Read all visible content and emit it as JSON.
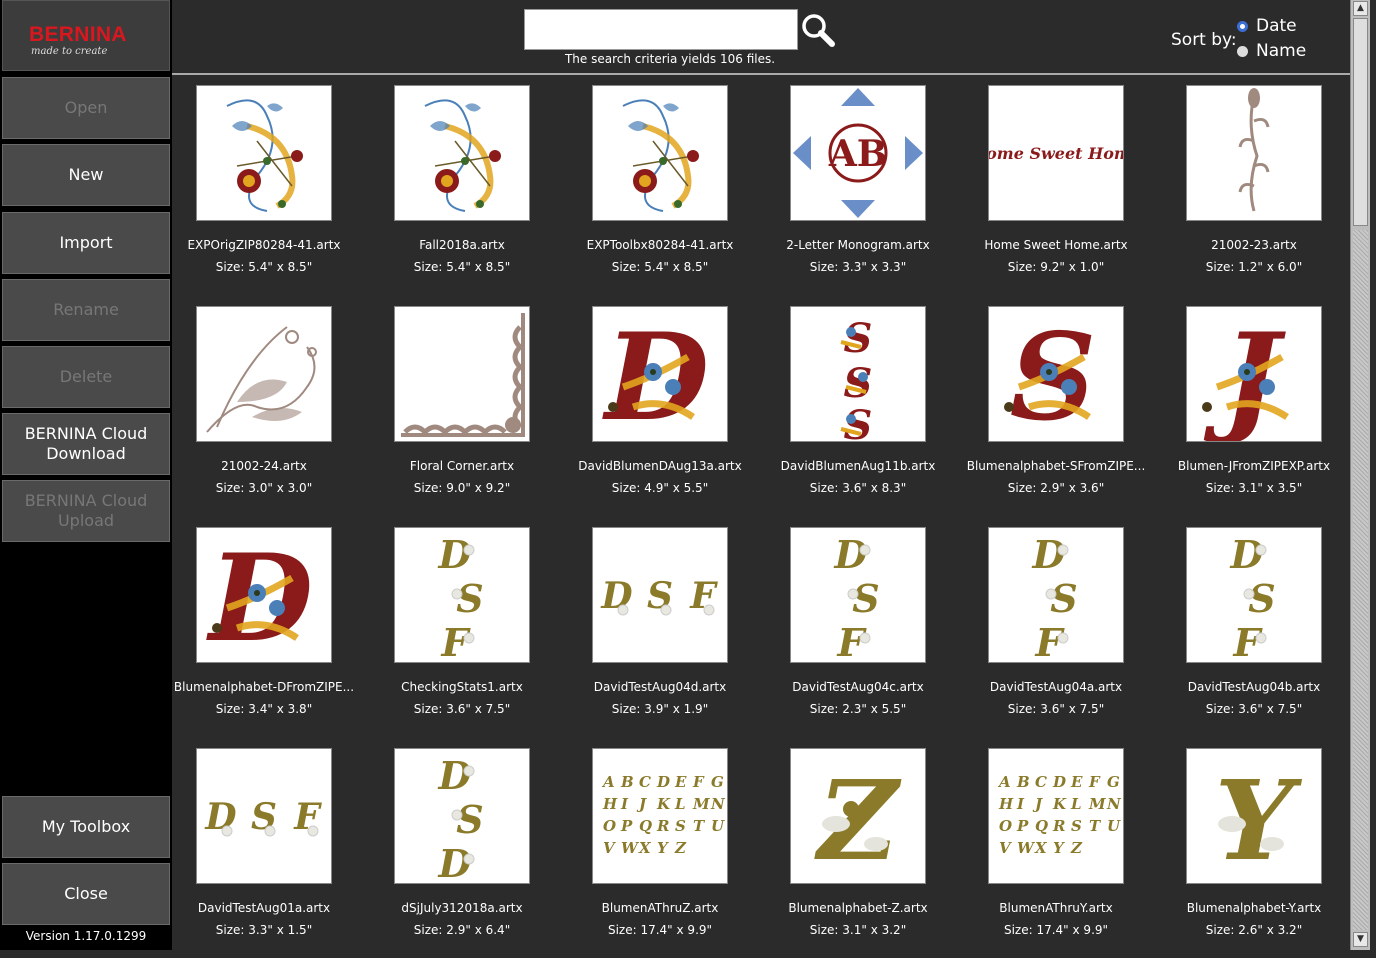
{
  "brand": {
    "name": "BERNINA",
    "tagline": "made to create"
  },
  "sidebar": {
    "buttons": [
      {
        "label": "Open",
        "enabled": false
      },
      {
        "label": "New",
        "enabled": true
      },
      {
        "label": "Import",
        "enabled": true
      },
      {
        "label": "Rename",
        "enabled": false
      },
      {
        "label": "Delete",
        "enabled": false
      },
      {
        "label": "BERNINA Cloud\nDownload",
        "enabled": true
      },
      {
        "label": "BERNINA Cloud\nUpload",
        "enabled": false
      }
    ],
    "bottom_buttons": [
      {
        "label": "My Toolbox",
        "enabled": true
      },
      {
        "label": "Close",
        "enabled": true
      }
    ],
    "version": "Version 1.17.0.1299"
  },
  "search": {
    "value": "",
    "result_text": "The search criteria yields 106 files."
  },
  "sort": {
    "label": "Sort by:",
    "options": [
      {
        "label": "Date",
        "selected": true
      },
      {
        "label": "Name",
        "selected": false
      }
    ]
  },
  "files": [
    {
      "name": "EXPOrigZIP80284-41.artx",
      "size": "Size: 5.4\" x 8.5\"",
      "art": "floral-wreath"
    },
    {
      "name": "Fall2018a.artx",
      "size": "Size: 5.4\" x 8.5\"",
      "art": "floral-wreath"
    },
    {
      "name": "EXPToolbx80284-41.artx",
      "size": "Size: 5.4\" x 8.5\"",
      "art": "floral-wreath"
    },
    {
      "name": "2-Letter Monogram.artx",
      "size": "Size: 3.3\" x 3.3\"",
      "art": "monogram",
      "art_text": "AB"
    },
    {
      "name": "Home Sweet Home.artx",
      "size": "Size: 9.2\" x 1.0\"",
      "art": "script-text",
      "art_text": "Home Sweet Home"
    },
    {
      "name": "21002-23.artx",
      "size": "Size: 1.2\" x 6.0\"",
      "art": "vine"
    },
    {
      "name": "21002-24.artx",
      "size": "Size: 3.0\" x 3.0\"",
      "art": "corner-swirl"
    },
    {
      "name": "Floral Corner.artx",
      "size": "Size: 9.0\" x 9.2\"",
      "art": "floral-corner"
    },
    {
      "name": "DavidBlumenDAug13a.artx",
      "size": "Size: 4.9\" x 5.5\"",
      "art": "letter-red",
      "art_text": "D"
    },
    {
      "name": "DavidBlumenAug11b.artx",
      "size": "Size: 3.6\" x 8.3\"",
      "art": "stack-red",
      "art_text": "S"
    },
    {
      "name": "Blumenalphabet-SFromZIPE...",
      "size": "Size: 2.9\" x 3.6\"",
      "art": "letter-red",
      "art_text": "S"
    },
    {
      "name": "Blumen-JFromZIPEXP.artx",
      "size": "Size: 3.1\" x 3.5\"",
      "art": "letter-red",
      "art_text": "J"
    },
    {
      "name": "Blumenalphabet-DFromZIPE...",
      "size": "Size: 3.4\" x 3.8\"",
      "art": "letter-red",
      "art_text": "D"
    },
    {
      "name": "CheckingStats1.artx",
      "size": "Size: 3.6\" x 7.5\"",
      "art": "stack-gold",
      "art_text": "DSF"
    },
    {
      "name": "DavidTestAug04d.artx",
      "size": "Size: 3.9\" x 1.9\"",
      "art": "row-gold",
      "art_text": "DSF"
    },
    {
      "name": "DavidTestAug04c.artx",
      "size": "Size: 2.3\" x 5.5\"",
      "art": "stack-gold",
      "art_text": "DSF"
    },
    {
      "name": "DavidTestAug04a.artx",
      "size": "Size: 3.6\" x 7.5\"",
      "art": "stack-gold",
      "art_text": "DSF"
    },
    {
      "name": "DavidTestAug04b.artx",
      "size": "Size: 3.6\" x 7.5\"",
      "art": "stack-gold",
      "art_text": "DSF"
    },
    {
      "name": "DavidTestAug01a.artx",
      "size": "Size: 3.3\" x 1.5\"",
      "art": "row-gold",
      "art_text": "DSF"
    },
    {
      "name": "dSjJuly312018a.artx",
      "size": "Size: 2.9\" x 6.4\"",
      "art": "stack-gold",
      "art_text": "DSD"
    },
    {
      "name": "BlumenAThruZ.artx",
      "size": "Size: 17.4\" x 9.9\"",
      "art": "alphabet-grid"
    },
    {
      "name": "Blumenalphabet-Z.artx",
      "size": "Size: 3.1\" x 3.2\"",
      "art": "letter-gold",
      "art_text": "Z"
    },
    {
      "name": "BlumenAThruY.artx",
      "size": "Size: 17.4\" x 9.9\"",
      "art": "alphabet-grid"
    },
    {
      "name": "Blumenalphabet-Y.artx",
      "size": "Size: 2.6\" x 3.2\"",
      "art": "letter-gold",
      "art_text": "Y"
    }
  ],
  "colors": {
    "red_thread": "#8b1a1a",
    "gold_thread": "#8a7a2a",
    "yellow_thread": "#e2a51f",
    "blue_thread": "#4a7fb8",
    "taupe_thread": "#a08a80",
    "accent": "#3b6fd6"
  }
}
